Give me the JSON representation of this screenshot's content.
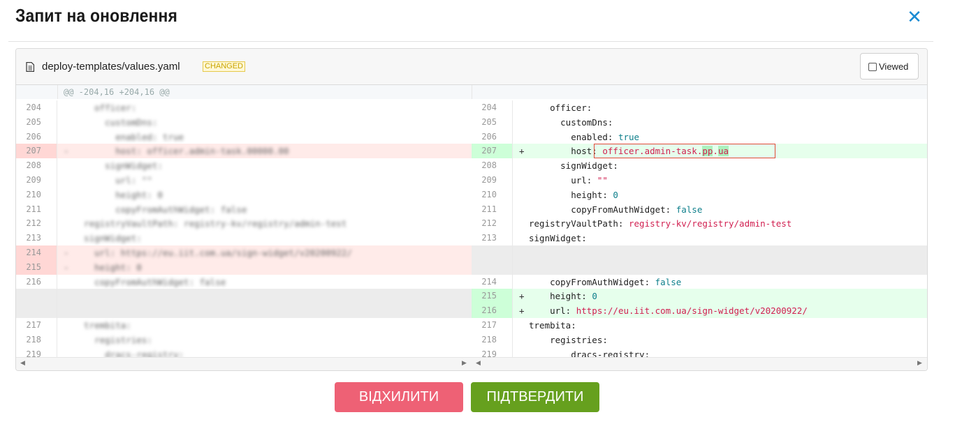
{
  "dialog": {
    "title": "Запит на оновлення",
    "close_label": "✕"
  },
  "file": {
    "name": "deploy-templates/values.yaml",
    "badge": "CHANGED",
    "viewed_label": "Viewed",
    "viewed_checked": false
  },
  "diff": {
    "hunk_header": "@@ -204,16 +204,16 @@",
    "left": [
      {
        "ln": "204",
        "mk": "",
        "text": "    officer:",
        "type": "ctx"
      },
      {
        "ln": "205",
        "mk": "",
        "text": "      customDns:",
        "type": "ctx"
      },
      {
        "ln": "206",
        "mk": "",
        "text": "        enabled: true",
        "type": "ctx"
      },
      {
        "ln": "207",
        "mk": "-",
        "text": "        host: officer.admin-task.00000.00",
        "type": "del"
      },
      {
        "ln": "208",
        "mk": "",
        "text": "      signWidget:",
        "type": "ctx"
      },
      {
        "ln": "209",
        "mk": "",
        "text": "        url: \"\"",
        "type": "ctx"
      },
      {
        "ln": "210",
        "mk": "",
        "text": "        height: 0",
        "type": "ctx"
      },
      {
        "ln": "211",
        "mk": "",
        "text": "        copyFromAuthWidget: false",
        "type": "ctx"
      },
      {
        "ln": "212",
        "mk": "",
        "text": "  registryVaultPath: registry-kv/registry/admin-test",
        "type": "ctx"
      },
      {
        "ln": "213",
        "mk": "",
        "text": "  signWidget:",
        "type": "ctx"
      },
      {
        "ln": "214",
        "mk": "-",
        "text": "    url: https://eu.iit.com.ua/sign-widget/v20200922/",
        "type": "del"
      },
      {
        "ln": "215",
        "mk": "-",
        "text": "    height: 0",
        "type": "del"
      },
      {
        "ln": "216",
        "mk": "",
        "text": "    copyFromAuthWidget: false",
        "type": "ctx"
      },
      {
        "ln": "",
        "mk": "",
        "text": "",
        "type": "empty"
      },
      {
        "ln": "",
        "mk": "",
        "text": "",
        "type": "empty"
      },
      {
        "ln": "217",
        "mk": "",
        "text": "  trembita:",
        "type": "ctx"
      },
      {
        "ln": "218",
        "mk": "",
        "text": "    registries:",
        "type": "ctx"
      },
      {
        "ln": "219",
        "mk": "",
        "text": "      dracs-registry:",
        "type": "ctx"
      }
    ],
    "right": [
      {
        "ln": "204",
        "mk": "",
        "key": "    officer:",
        "val": "",
        "vclass": "",
        "type": "ctx"
      },
      {
        "ln": "205",
        "mk": "",
        "key": "      customDns:",
        "val": "",
        "vclass": "",
        "type": "ctx"
      },
      {
        "ln": "206",
        "mk": "",
        "key": "        enabled: ",
        "val": "true",
        "vclass": "b",
        "type": "ctx"
      },
      {
        "ln": "207",
        "mk": "+",
        "key": "        host: ",
        "val": "officer.admin-task.",
        "vclass": "v",
        "hl1": "pp",
        "sep": ".",
        "hl2": "ua",
        "type": "add"
      },
      {
        "ln": "208",
        "mk": "",
        "key": "      signWidget:",
        "val": "",
        "vclass": "",
        "type": "ctx"
      },
      {
        "ln": "209",
        "mk": "",
        "key": "        url: ",
        "val": "\"\"",
        "vclass": "v",
        "type": "ctx"
      },
      {
        "ln": "210",
        "mk": "",
        "key": "        height: ",
        "val": "0",
        "vclass": "b",
        "type": "ctx"
      },
      {
        "ln": "211",
        "mk": "",
        "key": "        copyFromAuthWidget: ",
        "val": "false",
        "vclass": "b",
        "type": "ctx"
      },
      {
        "ln": "212",
        "mk": "",
        "key": "registryVaultPath: ",
        "val": "registry-kv/registry/admin-test",
        "vclass": "v",
        "type": "ctx"
      },
      {
        "ln": "213",
        "mk": "",
        "key": "signWidget:",
        "val": "",
        "vclass": "",
        "type": "ctx"
      },
      {
        "ln": "",
        "mk": "",
        "key": "",
        "val": "",
        "vclass": "",
        "type": "empty"
      },
      {
        "ln": "",
        "mk": "",
        "key": "",
        "val": "",
        "vclass": "",
        "type": "empty"
      },
      {
        "ln": "214",
        "mk": "",
        "key": "    copyFromAuthWidget: ",
        "val": "false",
        "vclass": "b",
        "type": "ctx"
      },
      {
        "ln": "215",
        "mk": "+",
        "key": "    height: ",
        "val": "0",
        "vclass": "b",
        "type": "add"
      },
      {
        "ln": "216",
        "mk": "+",
        "key": "    url: ",
        "val": "https://eu.iit.com.ua/sign-widget/v20200922/",
        "vclass": "v",
        "type": "add"
      },
      {
        "ln": "217",
        "mk": "",
        "key": "trembita:",
        "val": "",
        "vclass": "",
        "type": "ctx"
      },
      {
        "ln": "218",
        "mk": "",
        "key": "    registries:",
        "val": "",
        "vclass": "",
        "type": "ctx"
      },
      {
        "ln": "219",
        "mk": "",
        "key": "        dracs-registry:",
        "val": "",
        "vclass": "",
        "type": "ctx"
      }
    ]
  },
  "actions": {
    "reject_label": "ВІДХИЛИТИ",
    "approve_label": "ПІДТВЕРДИТИ"
  },
  "colors": {
    "reject": "#ee6175",
    "approve": "#66a01e",
    "close": "#1b8bd3",
    "added_row": "#e6ffec",
    "deleted_row": "#ffebe9"
  }
}
